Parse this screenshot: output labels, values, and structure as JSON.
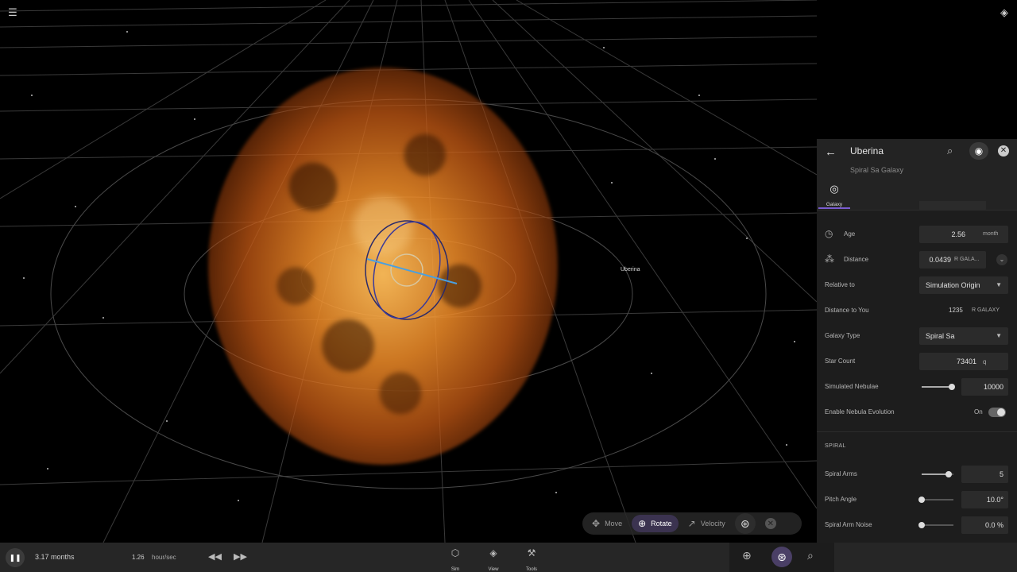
{
  "viewport": {
    "object_label": "Uberina",
    "menu_icon": "hamburger-menu-icon",
    "layers_icon": "layers-icon"
  },
  "manipulator": {
    "move": "Move",
    "rotate": "Rotate",
    "velocity": "Velocity"
  },
  "panel": {
    "title": "Uberina",
    "subtitle": "Spiral Sa Galaxy",
    "tab_label": "Galaxy",
    "age": {
      "label": "Age",
      "value": "2.56",
      "unit": "month"
    },
    "distance": {
      "label": "Distance",
      "value": "0.0439",
      "unit": "R GALA..."
    },
    "relative_to": {
      "label": "Relative to",
      "value": "Simulation Origin"
    },
    "distance_to_you": {
      "label": "Distance to You",
      "value": "1235",
      "unit": "R GALAXY"
    },
    "galaxy_type": {
      "label": "Galaxy Type",
      "value": "Spiral Sa"
    },
    "star_count": {
      "label": "Star Count",
      "value": "73401",
      "unit": "q"
    },
    "simulated_nebulae": {
      "label": "Simulated Nebulae",
      "value": "10000",
      "fraction": 0.95
    },
    "nebula_evolution": {
      "label": "Enable Nebula Evolution",
      "state": "On"
    },
    "spiral_section": "SPIRAL",
    "spiral_arms": {
      "label": "Spiral Arms",
      "value": "5",
      "fraction": 0.85
    },
    "pitch_angle": {
      "label": "Pitch Angle",
      "value": "10.0°",
      "fraction": 0.0
    },
    "spiral_arm_noise": {
      "label": "Spiral Arm Noise",
      "value": "0.0 %",
      "fraction": 0.0
    }
  },
  "bottombar": {
    "elapsed": "3.17 months",
    "rate_value": "1.26",
    "rate_unit": "hour/sec",
    "nav": [
      {
        "label": "Sim",
        "icon": "cube-icon"
      },
      {
        "label": "View",
        "icon": "layers-icon"
      },
      {
        "label": "Tools",
        "icon": "wrench-icon"
      }
    ]
  }
}
